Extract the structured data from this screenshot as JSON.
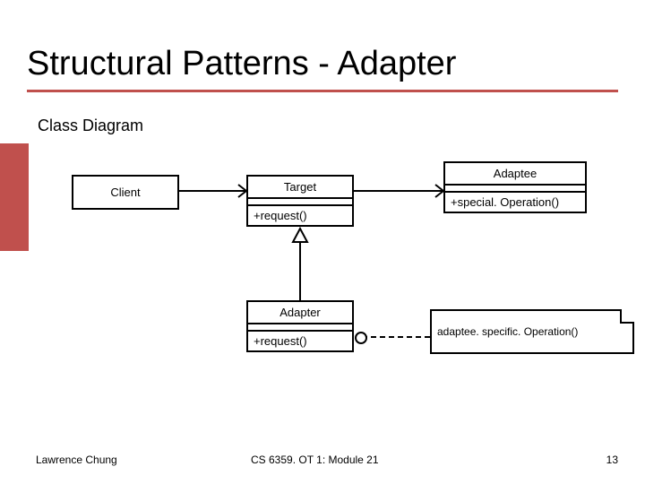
{
  "title": "Structural Patterns - Adapter",
  "subtitle": "Class Diagram",
  "boxes": {
    "client": {
      "name": "Client"
    },
    "target": {
      "name": "Target",
      "op": "+request()"
    },
    "adaptee": {
      "name": "Adaptee",
      "op": "+special. Operation()"
    },
    "adapter": {
      "name": "Adapter",
      "op": "+request()"
    }
  },
  "note": "adaptee. specific. Operation()",
  "footer": {
    "author": "Lawrence Chung",
    "course": "CS 6359. OT 1: Module 21",
    "page": "13"
  }
}
